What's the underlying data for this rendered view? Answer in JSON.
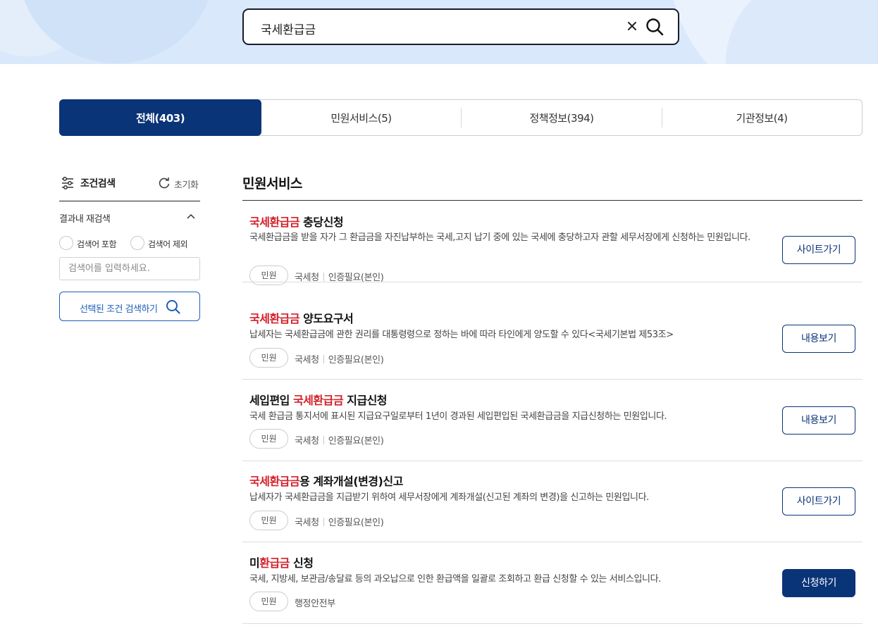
{
  "search": {
    "query": "국세환급금"
  },
  "tabs": [
    {
      "label": "전체(403)"
    },
    {
      "label": "민원서비스(5)"
    },
    {
      "label": "정책정보(394)"
    },
    {
      "label": "기관정보(4)"
    }
  ],
  "sidebar": {
    "title": "조건검색",
    "reset_label": "초기화",
    "re_search_title": "결과내 재검색",
    "options": [
      {
        "label": "검색어 포함"
      },
      {
        "label": "검색어 제외"
      }
    ],
    "input_placeholder": "검색어를 입력하세요.",
    "search_button_label": "선택된 조건 검색하기"
  },
  "main": {
    "section_title": "민원서비스",
    "results": [
      {
        "title_pre": "",
        "title_hl": "국세환급금",
        "title_post": " 충당신청",
        "desc": "국세환급금을 받을 자가 그 환급금을 자진납부하는 국세,고지 납기 중에 있는 국세에 충당하고자 관할 세무서장에게 신청하는 민원입니다.",
        "tag": "민원",
        "agency": "국세청",
        "auth": "인증필요(본인)",
        "button": "사이트가기"
      },
      {
        "title_pre": "",
        "title_hl": "국세환급금",
        "title_post": " 양도요구서",
        "desc": "납세자는 국세환급금에 관한 권리를 대통령령으로 정하는 바에 따라 타인에게 양도할 수 있다<국세기본법 제53조>",
        "tag": "민원",
        "agency": "국세청",
        "auth": "인증필요(본인)",
        "button": "내용보기"
      },
      {
        "title_pre": "세입편입 ",
        "title_hl": "국세환급금",
        "title_post": " 지급신청",
        "desc": "국세 환급금 통지서에 표시된 지급요구일로부터 1년이 경과된 세입편입된 국세환급금을 지급신청하는 민원입니다.",
        "tag": "민원",
        "agency": "국세청",
        "auth": "인증필요(본인)",
        "button": "내용보기"
      },
      {
        "title_pre": "",
        "title_hl": "국세환급금",
        "title_post": "용 계좌개설(변경)신고",
        "desc": "납세자가 국세환급금을 지급받기 위하여 세무서장에게 계좌개설(신고된 계좌의 변경)을 신고하는 민원입니다.",
        "tag": "민원",
        "agency": "국세청",
        "auth": "인증필요(본인)",
        "button": "사이트가기"
      },
      {
        "title_pre": "미",
        "title_hl": "환급금",
        "title_post": " 신청",
        "desc": "국세, 지방세, 보관금/송달료 등의 과오납으로 인한 환급액을 일괄로 조회하고 환급 신청할 수 있는 서비스입니다.",
        "tag": "민원",
        "agency": "행정안전부",
        "auth": "",
        "button": "신청하기"
      }
    ]
  },
  "colors": {
    "primary": "#0a3478",
    "highlight": "#d4202a",
    "banner": "#d9e9fb"
  }
}
